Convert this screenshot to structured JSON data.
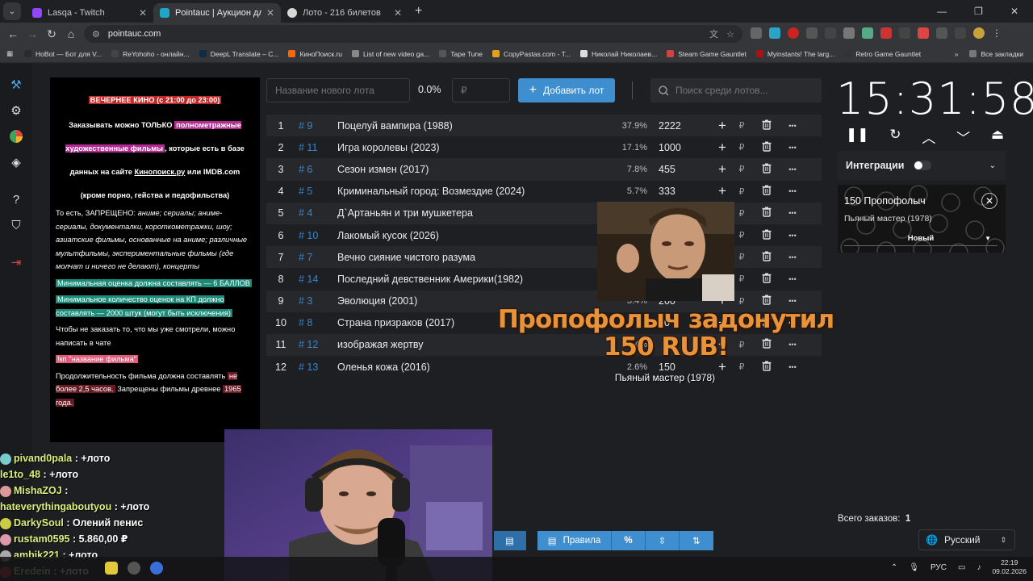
{
  "browser": {
    "tabs": [
      {
        "title": "Lasqa - Twitch",
        "color": "#9146ff",
        "active": false
      },
      {
        "title": "Pointauc | Аукцион для стримеров",
        "color": "#1fa5c8",
        "active": true
      },
      {
        "title": "Лото - 216 билетов",
        "color": "#d8d8d8",
        "active": false
      }
    ],
    "url": "pointauc.com",
    "bookmarks": [
      {
        "label": "HoBot — Бот для V...",
        "color": "#2b2b2b"
      },
      {
        "label": "ReYohoho - онлайн...",
        "color": "#444"
      },
      {
        "label": "DeepL Translate – С...",
        "color": "#0f2b46"
      },
      {
        "label": "КиноПоиск.ru",
        "color": "#f60"
      },
      {
        "label": "List of new video ga...",
        "color": "#888"
      },
      {
        "label": "Tape Tune",
        "color": "#555"
      },
      {
        "label": "CopyPastas.com - T...",
        "color": "#e0a020"
      },
      {
        "label": "Николай Николаев...",
        "color": "#ddd"
      },
      {
        "label": "Steam Game Gauntlet",
        "color": "#c44"
      },
      {
        "label": "Myinstants! The larg...",
        "color": "#b01010"
      },
      {
        "label": "Retro Game Gauntlet",
        "color": "#333"
      }
    ],
    "all_bookmarks": "Все закладки"
  },
  "rules": {
    "title": "ВЕЧЕРНЕЕ КИНО (с 21:00 до 23:00)",
    "p1_a": "Заказывать можно ТОЛЬКО ",
    "p1_hl": "полнометражные художественные фильмы",
    "p1_b": ", которые есть в базе данных на сайте ",
    "p1_link": "Кинопоиск.ру",
    "p1_c": " или IMDB.com",
    "p2": "(кроме порно, гейства и педофильства)",
    "p3_a": "То есть, ЗАПРЕЩЕНО: ",
    "p3_it": "аниме; сериалы; аниме-сериалы, документалки, короткометражки, шоу; азиатские фильмы, основанные на аниме; различные мультфильмы, экспериментальные фильмы (где молчат и ничего не делают), концерты",
    "p4": "Минимальная оценка должна составлять — 6 БАЛЛОВ",
    "p5": "Минимальное количество оценок на КП должно составлять — 2000 штук (могут быть исключения)",
    "p6": "Чтобы не заказать то, что мы уже смотрели, можно написать в чате",
    "p7": "!кп \"название фильма\"",
    "p8_a": "Продолжительность фильма должна составлять ",
    "p8_hl": "не более 2,5 часов.",
    "p8_b": " Запрещены фильмы древнее ",
    "p8_hl2": "1965 года."
  },
  "toolbar": {
    "lot_placeholder": "Название нового лота",
    "percent": "0.0%",
    "rub_placeholder": "₽",
    "add_label": "Добавить лот",
    "search_placeholder": "Поиск среди лотов..."
  },
  "lots": [
    {
      "n": "1",
      "id": "# 9",
      "name": "Поцелуй вампира (1988)",
      "pct": "37.9%",
      "amount": "2222"
    },
    {
      "n": "2",
      "id": "# 11",
      "name": "Игра королевы (2023)",
      "pct": "17.1%",
      "amount": "1000"
    },
    {
      "n": "3",
      "id": "# 6",
      "name": "Сезон измен (2017)",
      "pct": "7.8%",
      "amount": "455"
    },
    {
      "n": "4",
      "id": "# 5",
      "name": "Криминальный город: Возмездие (2024)",
      "pct": "5.7%",
      "amount": "333"
    },
    {
      "n": "5",
      "id": "# 4",
      "name": "Д`Артаньян и три мушкетера",
      "pct": "",
      "amount": ""
    },
    {
      "n": "6",
      "id": "# 10",
      "name": "Лакомый кусок (2026)",
      "pct": "",
      "amount": ""
    },
    {
      "n": "7",
      "id": "# 7",
      "name": "Вечно сияние чистого разума",
      "pct": "",
      "amount": ""
    },
    {
      "n": "8",
      "id": "# 14",
      "name": "Последний девственник Америки(1982)",
      "pct": "",
      "amount": ""
    },
    {
      "n": "9",
      "id": "# 3",
      "name": "Эволюция (2001)",
      "pct": "3.4%",
      "amount": "200"
    },
    {
      "n": "10",
      "id": "# 8",
      "name": "Страна призраков (2017)",
      "pct": "",
      "amount": "00"
    },
    {
      "n": "11",
      "id": "# 12",
      "name": "изображая жертву",
      "pct": "3.4%",
      "amount": ""
    },
    {
      "n": "12",
      "id": "# 13",
      "name": "Оленья кожа (2016)",
      "pct": "2.6%",
      "amount": "150"
    }
  ],
  "timer": {
    "time": "15:31:58"
  },
  "integrations": {
    "label": "Интеграции"
  },
  "donation": {
    "title": "150 Пропофолыч",
    "subtitle": "Пьяный мастер (1978)",
    "status": "Новый"
  },
  "alert": {
    "text": "Пропофолыч задонутил 150 RUB!",
    "subtitle": "Пьяный мастер (1978)"
  },
  "chat": [
    {
      "user": "pivand0pala",
      "msg": "+лото",
      "emote": "#7cc"
    },
    {
      "user": "le1to_48",
      "msg": "+лото",
      "emote": ""
    },
    {
      "user": "MishaZOJ",
      "msg": "",
      "emote": "#d99"
    },
    {
      "user": "hateverythingaboutyou",
      "msg": "+лото",
      "emote": ""
    },
    {
      "user": "DarkySoul",
      "msg": "Олений пенис",
      "emote": "#cc4"
    },
    {
      "user": "rustam0595",
      "msg": "5.860,00 ₽",
      "emote": "#d9a"
    },
    {
      "user": "ambik221",
      "msg": "+лото",
      "emote": "#aaa"
    },
    {
      "user": "Eredein",
      "msg": "+лото",
      "emote": "#c33"
    }
  ],
  "bottom": {
    "rules_label": "Правила",
    "percent_icon": "%"
  },
  "totals": {
    "label": "Всего заказов:",
    "value": "1"
  },
  "language": {
    "selected": "Русский"
  },
  "taskbar": {
    "lang": "РУС",
    "time": "22:19",
    "date": "09.02.2026"
  }
}
